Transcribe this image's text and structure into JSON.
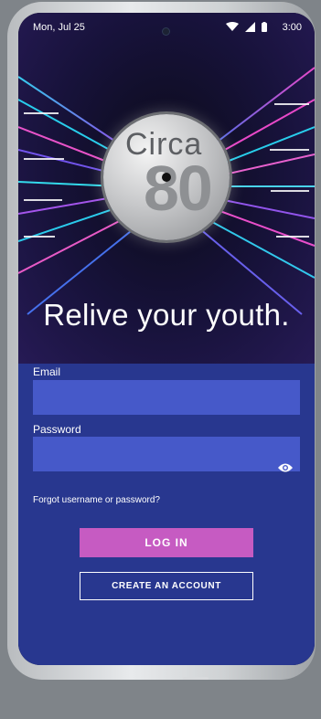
{
  "status_bar": {
    "date": "Mon, Jul 25",
    "time": "3:00",
    "icons": [
      "wifi-icon",
      "signal-icon",
      "battery-icon"
    ]
  },
  "hero": {
    "logo_word": "Circa",
    "logo_number": "80",
    "tagline": "Relive your youth."
  },
  "form": {
    "email_label": "Email",
    "email_value": "",
    "password_label": "Password",
    "password_value": "",
    "password_toggle_icon": "eye-icon",
    "forgot_link": "Forgot username or password?",
    "login_button": "LOG IN",
    "create_account_button": "CREATE AN ACCOUNT"
  },
  "colors": {
    "panel_background": "#28378f",
    "input_background": "#4659c9",
    "login_button": "#c65bc2"
  }
}
